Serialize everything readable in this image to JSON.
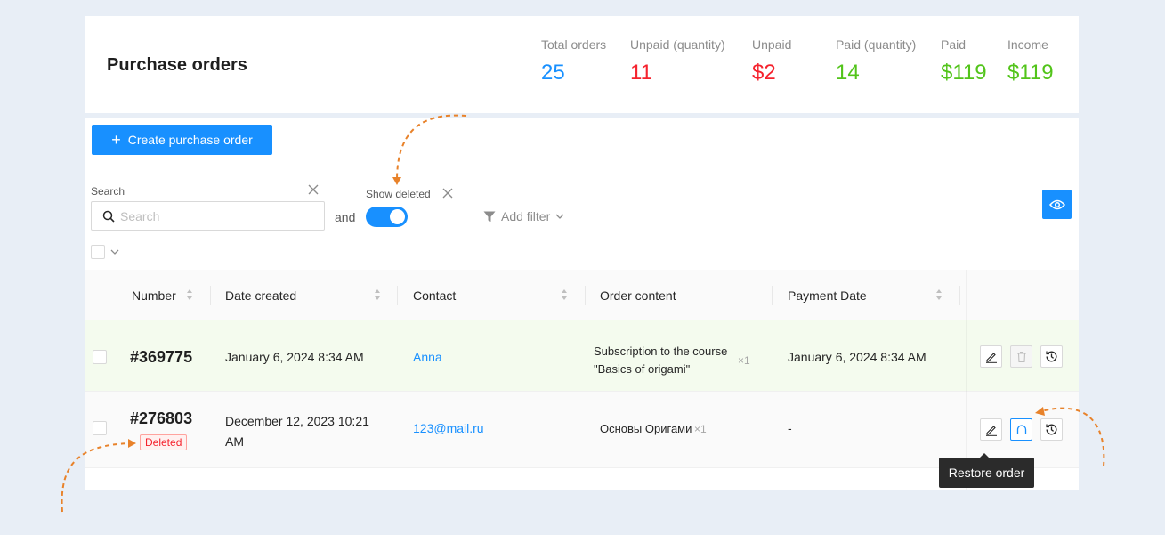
{
  "header": {
    "title": "Purchase orders",
    "stats": [
      {
        "label": "Total orders",
        "value": "25",
        "color": "#1890ff"
      },
      {
        "label": "Unpaid (quantity)",
        "value": "11",
        "color": "#f5222d"
      },
      {
        "label": "Unpaid",
        "value": "$2",
        "color": "#f5222d"
      },
      {
        "label": "Paid (quantity)",
        "value": "14",
        "color": "#52c41a"
      },
      {
        "label": "Paid",
        "value": "$119",
        "color": "#52c41a"
      },
      {
        "label": "Income",
        "value": "$119",
        "color": "#52c41a"
      }
    ]
  },
  "toolbar": {
    "create_label": "Create purchase order",
    "search_label": "Search",
    "search_placeholder": "Search",
    "and_label": "and",
    "show_deleted_label": "Show deleted",
    "show_deleted_on": true,
    "add_filter_label": "Add filter"
  },
  "table": {
    "columns": [
      "Number",
      "Date created",
      "Contact",
      "Order content",
      "Payment Date"
    ],
    "rows": [
      {
        "number": "#369775",
        "date_created": "January 6, 2024 8:34 AM",
        "contact": "Anna",
        "content": "Subscription to the course \"Basics of origami\"",
        "qty": "×1",
        "payment_date": "January 6, 2024 8:34 AM",
        "deleted": false
      },
      {
        "number": "#276803",
        "date_created": "December 12, 2023 10:21 AM",
        "contact": "123@mail.ru",
        "content": "Основы Оригами",
        "qty": "×1",
        "payment_date": "-",
        "deleted": true,
        "deleted_label": "Deleted"
      }
    ]
  },
  "tooltip": {
    "text": "Restore order"
  },
  "colors": {
    "accent": "#1890ff",
    "annotation": "#e8822a",
    "paid_row_bg": "#f4fbee"
  }
}
